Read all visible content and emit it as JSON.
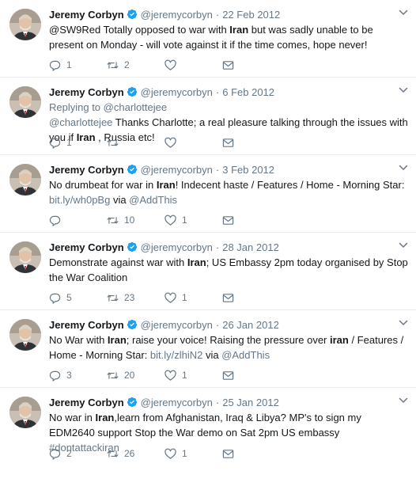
{
  "author": {
    "name": "Jeremy Corbyn",
    "handle": "@jeremycorbyn"
  },
  "colors": {
    "secondary": "#657786",
    "text": "#14171a",
    "verified": "#1da1f2",
    "divider": "#e6ecf0"
  },
  "tweets": [
    {
      "date": "22 Feb 2012",
      "parts": [
        "@SW9Red Totally opposed to war with ",
        "Iran",
        " but was sadly unable to be present on Monday - will vote against it if the time comes, hope never!"
      ],
      "reply_count": "1",
      "retweet_count": "2",
      "like_count": ""
    },
    {
      "date": "6 Feb 2012",
      "replying_label": "Replying to ",
      "replying_to": "@charlottejee",
      "mention": "@charlottejee",
      "parts": [
        " Thanks Charlotte; a real pleasure talking through the issues with you if ",
        "Iran",
        " , Russia etc!"
      ],
      "reply_count": "1",
      "retweet_count": "",
      "like_count": ""
    },
    {
      "date": "3 Feb 2012",
      "parts": [
        "No drumbeat for war in ",
        "Iran",
        "! Indecent haste / Features / Home - Morning Star: "
      ],
      "link": "bit.ly/wh0pBg",
      "via": " via ",
      "via_src": "@AddThis",
      "reply_count": "",
      "retweet_count": "10",
      "like_count": "1"
    },
    {
      "date": "28 Jan 2012",
      "parts": [
        "Demonstrate against war with ",
        "Iran",
        "; US Embassy 2pm today organised by Stop the War Coalition"
      ],
      "reply_count": "5",
      "retweet_count": "23",
      "like_count": "1"
    },
    {
      "date": "26 Jan 2012",
      "parts": [
        "No War with ",
        "Iran",
        "; raise your voice! Raising the pressure over ",
        "iran",
        " / Features / Home - Morning Star: "
      ],
      "link": "bit.ly/zlhiN2",
      "via": " via ",
      "via_src": "@AddThis",
      "reply_count": "3",
      "retweet_count": "20",
      "like_count": "1"
    },
    {
      "date": "25 Jan 2012",
      "parts": [
        "No war in ",
        "Iran",
        ",learn from Afghanistan, Iraq & Libya? MP's to sign my EDM2640 support Stop the War demo on Sat 2pm US embassy "
      ],
      "hashtag": "#dontattackiran",
      "reply_count": "2",
      "retweet_count": "26",
      "like_count": "1"
    }
  ]
}
